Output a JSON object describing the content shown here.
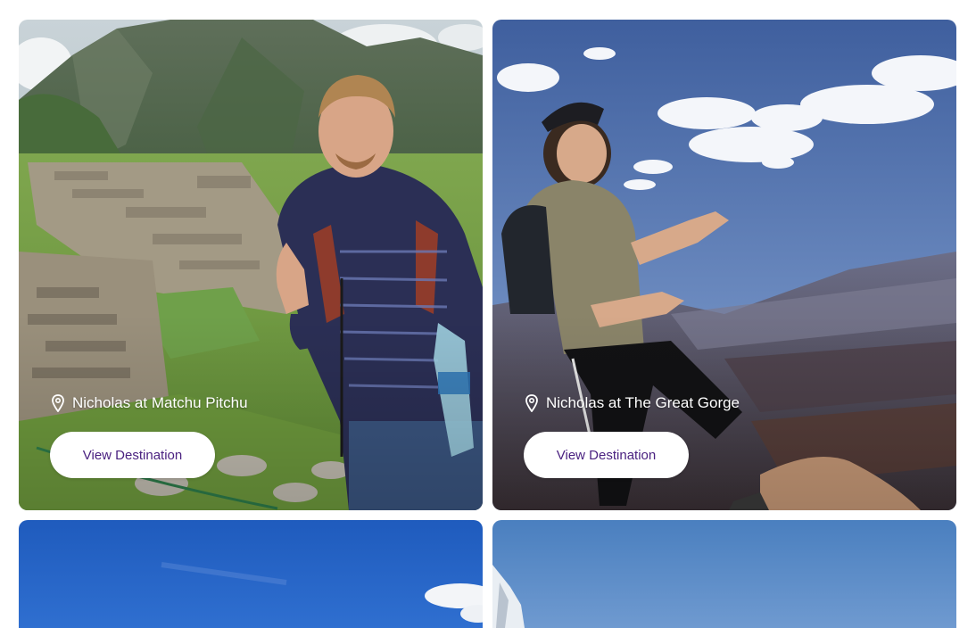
{
  "destinations": [
    {
      "caption": "Nicholas at Matchu Pitchu",
      "button_label": "View Destination"
    },
    {
      "caption": "Nicholas at The Great Gorge",
      "button_label": "View Destination"
    }
  ],
  "icons": {
    "location": "map-pin-icon"
  },
  "colors": {
    "button_bg": "#ffffff",
    "button_text": "#4a2180",
    "caption_text": "#ffffff"
  }
}
